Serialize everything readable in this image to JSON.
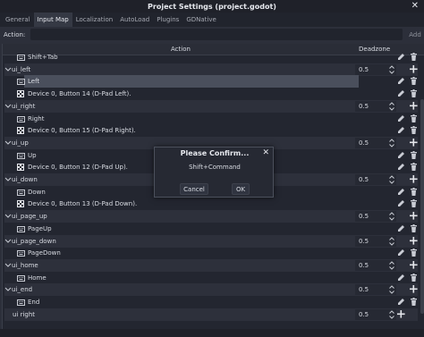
{
  "window": {
    "title": "Project Settings (project.godot)",
    "close_glyph": "✕"
  },
  "tabs": [
    "General",
    "Input Map",
    "Localization",
    "AutoLoad",
    "Plugins",
    "GDNative"
  ],
  "action_bar": {
    "label": "Action:",
    "value": "",
    "add_label": "Add"
  },
  "table": {
    "col_action": "Action",
    "col_deadzone": "Deadzone"
  },
  "rows": [
    {
      "type": "event",
      "icon": "keyboard-icon",
      "text": "Shift+Tab"
    },
    {
      "type": "group",
      "text": "ui_left",
      "deadzone": "0.5"
    },
    {
      "type": "event",
      "icon": "keyboard-icon",
      "text": "Left",
      "selected": true
    },
    {
      "type": "event",
      "icon": "gamepad-icon",
      "text": "Device 0, Button 14 (D-Pad Left)."
    },
    {
      "type": "group",
      "text": "ui_right",
      "deadzone": "0.5"
    },
    {
      "type": "event",
      "icon": "keyboard-icon",
      "text": "Right"
    },
    {
      "type": "event",
      "icon": "gamepad-icon",
      "text": "Device 0, Button 15 (D-Pad Right)."
    },
    {
      "type": "group",
      "text": "ui_up",
      "deadzone": "0.5"
    },
    {
      "type": "event",
      "icon": "keyboard-icon",
      "text": "Up"
    },
    {
      "type": "event",
      "icon": "gamepad-icon",
      "text": "Device 0, Button 12 (D-Pad Up)."
    },
    {
      "type": "group",
      "text": "ui_down",
      "deadzone": "0.5"
    },
    {
      "type": "event",
      "icon": "keyboard-icon",
      "text": "Down"
    },
    {
      "type": "event",
      "icon": "gamepad-icon",
      "text": "Device 0, Button 13 (D-Pad Down)."
    },
    {
      "type": "group",
      "text": "ui_page_up",
      "deadzone": "0.5"
    },
    {
      "type": "event",
      "icon": "keyboard-icon",
      "text": "PageUp"
    },
    {
      "type": "group",
      "text": "ui_page_down",
      "deadzone": "0.5"
    },
    {
      "type": "event",
      "icon": "keyboard-icon",
      "text": "PageDown"
    },
    {
      "type": "group",
      "text": "ui_home",
      "deadzone": "0.5"
    },
    {
      "type": "event",
      "icon": "keyboard-icon",
      "text": "Home"
    },
    {
      "type": "group",
      "text": "ui_end",
      "deadzone": "0.5"
    },
    {
      "type": "event",
      "icon": "keyboard-icon",
      "text": "End"
    },
    {
      "type": "group",
      "text": "ui right",
      "deadzone": "0.5",
      "nocaret": true
    }
  ],
  "dialog": {
    "title": "Please Confirm...",
    "message": "Shift+Command",
    "cancel_label": "Cancel",
    "ok_label": "OK",
    "close_glyph": "✕"
  },
  "colors": {
    "background": "#2c2f3a",
    "panel": "#232630",
    "group_row": "#2d303b",
    "selection": "#4a4f5c"
  }
}
